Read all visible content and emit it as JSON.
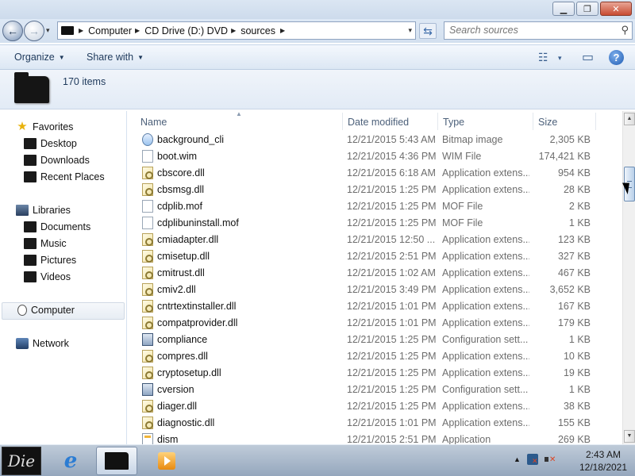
{
  "titlebar": {
    "minimize": "▁",
    "maximize": "❐",
    "close": "✕"
  },
  "navigation": {
    "back": "←",
    "forward": "→",
    "history_caret": "▾"
  },
  "address": {
    "crumbs": [
      "Computer",
      "CD Drive (D:) DVD",
      "sources"
    ],
    "dropdown": "▾",
    "refresh": "⇆"
  },
  "search": {
    "placeholder": "Search sources",
    "icon": "search-icon"
  },
  "toolbar": {
    "organize": "Organize",
    "share_with": "Share with",
    "views_icon": "☷",
    "views_caret": "▾",
    "preview_icon": "▭",
    "help": "?"
  },
  "details": {
    "count": "170 items"
  },
  "navpane": {
    "favorites": "Favorites",
    "desktop": "Desktop",
    "downloads": "Downloads",
    "recent": "Recent Places",
    "libraries": "Libraries",
    "documents": "Documents",
    "music": "Music",
    "pictures": "Pictures",
    "videos": "Videos",
    "computer": "Computer",
    "network": "Network"
  },
  "columns": {
    "name": "Name",
    "date": "Date modified",
    "type": "Type",
    "size": "Size"
  },
  "files": [
    {
      "name": "background_cli",
      "date": "12/21/2015 5:43 AM",
      "type": "Bitmap image",
      "size": "2,305 KB",
      "icon": "bmp"
    },
    {
      "name": "boot.wim",
      "date": "12/21/2015 4:36 PM",
      "type": "WIM File",
      "size": "174,421 KB",
      "icon": "file"
    },
    {
      "name": "cbscore.dll",
      "date": "12/21/2015 6:18 AM",
      "type": "Application extens...",
      "size": "954 KB",
      "icon": "dll"
    },
    {
      "name": "cbsmsg.dll",
      "date": "12/21/2015 1:25 PM",
      "type": "Application extens...",
      "size": "28 KB",
      "icon": "dll"
    },
    {
      "name": "cdplib.mof",
      "date": "12/21/2015 1:25 PM",
      "type": "MOF File",
      "size": "2 KB",
      "icon": "file"
    },
    {
      "name": "cdplibuninstall.mof",
      "date": "12/21/2015 1:25 PM",
      "type": "MOF File",
      "size": "1 KB",
      "icon": "file"
    },
    {
      "name": "cmiadapter.dll",
      "date": "12/21/2015 12:50 ...",
      "type": "Application extens...",
      "size": "123 KB",
      "icon": "dll"
    },
    {
      "name": "cmisetup.dll",
      "date": "12/21/2015 2:51 PM",
      "type": "Application extens...",
      "size": "327 KB",
      "icon": "dll"
    },
    {
      "name": "cmitrust.dll",
      "date": "12/21/2015 1:02 AM",
      "type": "Application extens...",
      "size": "467 KB",
      "icon": "dll"
    },
    {
      "name": "cmiv2.dll",
      "date": "12/21/2015 3:49 PM",
      "type": "Application extens...",
      "size": "3,652 KB",
      "icon": "dll"
    },
    {
      "name": "cntrtextinstaller.dll",
      "date": "12/21/2015 1:01 PM",
      "type": "Application extens...",
      "size": "167 KB",
      "icon": "dll"
    },
    {
      "name": "compatprovider.dll",
      "date": "12/21/2015 1:01 PM",
      "type": "Application extens...",
      "size": "179 KB",
      "icon": "dll"
    },
    {
      "name": "compliance",
      "date": "12/21/2015 1:25 PM",
      "type": "Configuration sett...",
      "size": "1 KB",
      "icon": "cfg"
    },
    {
      "name": "compres.dll",
      "date": "12/21/2015 1:25 PM",
      "type": "Application extens...",
      "size": "10 KB",
      "icon": "dll"
    },
    {
      "name": "cryptosetup.dll",
      "date": "12/21/2015 1:25 PM",
      "type": "Application extens...",
      "size": "19 KB",
      "icon": "dll"
    },
    {
      "name": "cversion",
      "date": "12/21/2015 1:25 PM",
      "type": "Configuration sett...",
      "size": "1 KB",
      "icon": "cfg"
    },
    {
      "name": "diager.dll",
      "date": "12/21/2015 1:25 PM",
      "type": "Application extens...",
      "size": "38 KB",
      "icon": "dll"
    },
    {
      "name": "diagnostic.dll",
      "date": "12/21/2015 1:01 PM",
      "type": "Application extens...",
      "size": "155 KB",
      "icon": "dll"
    },
    {
      "name": "dism",
      "date": "12/21/2015 2:51 PM",
      "type": "Application",
      "size": "269 KB",
      "icon": "app"
    }
  ],
  "taskbar": {
    "start": "Die",
    "clock_time": "2:43 AM",
    "clock_date": "12/18/2021",
    "tray_caret": "▲"
  },
  "colors": {
    "accent": "#1e395b",
    "selection": "#e7edf4",
    "taskbar": "#95a7bd"
  }
}
